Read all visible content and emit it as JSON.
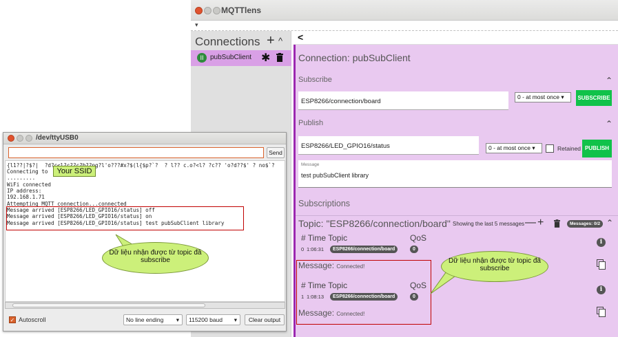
{
  "mqttlens": {
    "title": "MQTTlens",
    "connections_header": "Connections",
    "add_symbol": "+",
    "caret_up": "^",
    "connection_item": {
      "status_letter": "II",
      "name": "pubSubClient"
    },
    "back_symbol": "<",
    "connection_title": "Connection: pubSubClient",
    "subscribe": {
      "label": "Subscribe",
      "topic_value": "ESP8266/connection/board",
      "qos_value": "0 - at most once",
      "button": "SUBSCRIBE"
    },
    "publish": {
      "label": "Publish",
      "topic_value": "ESP8266/LED_GPIO16/status",
      "qos_value": "0 - at most once",
      "retained_label": "Retained",
      "button": "PUBLISH",
      "message_label": "Message",
      "message_value": "test pubSubClient library"
    },
    "subscriptions": {
      "label": "Subscriptions",
      "topic_title": "Topic: \"ESP8266/connection/board\"",
      "showing_text": "Showing the last 5 messages",
      "minus_symbol": "—",
      "plus_symbol": "+",
      "messages_badge": "Messages: 0/2",
      "messages": [
        {
          "hdr_hash": "# Time Topic",
          "hdr_qos": "QoS",
          "index": "0",
          "time": "1:06:31",
          "topic": "ESP8266/connection/board",
          "qos": "0",
          "message_label": "Message:",
          "message_value": "Connected!"
        },
        {
          "hdr_hash": "# Time Topic",
          "hdr_qos": "QoS",
          "index": "1",
          "time": "1:08:13",
          "topic": "ESP8266/connection/board",
          "qos": "0",
          "message_label": "Message:",
          "message_value": "Connected!"
        }
      ]
    },
    "colors": {
      "purple_accent": "#9c27b0",
      "panel_bg": "#e9c9f0",
      "green_button": "#10c24a",
      "selected_connection": "#d9a0e6"
    }
  },
  "serial": {
    "title": "/dev/ttyUSB0",
    "send_label": "Send",
    "console_lines": [
      "{l1??|?$?|  ?d?c<l?c??c?b??pg?l'o???#x?$(l{$p?`?  ? l?? c.o?<l? ?c?? 'o?d??$' ? no$`?",
      "Connecting to",
      ".........",
      "WiFi connected",
      "IP address:",
      "192.168.1.71",
      "Attempting MQTT connection...connected",
      "Message arrived [ESP8266/LED_GPIO16/status] off",
      "Message arrived [ESP8266/LED_GPIO16/status] on",
      "Message arrived [ESP8266/LED_GPIO16/status] test pubSubClient library"
    ],
    "autoscroll_label": "Autoscroll",
    "line_ending": "No line ending",
    "baud": "115200 baud",
    "clear_label": "Clear output"
  },
  "callouts": {
    "ssid": "Your SSID",
    "left_bubble": "Dữ liệu nhận được từ topic đã subscribe",
    "right_bubble": "Dữ liệu nhận được từ topic đã subscribe",
    "color": "#ccf07a"
  }
}
